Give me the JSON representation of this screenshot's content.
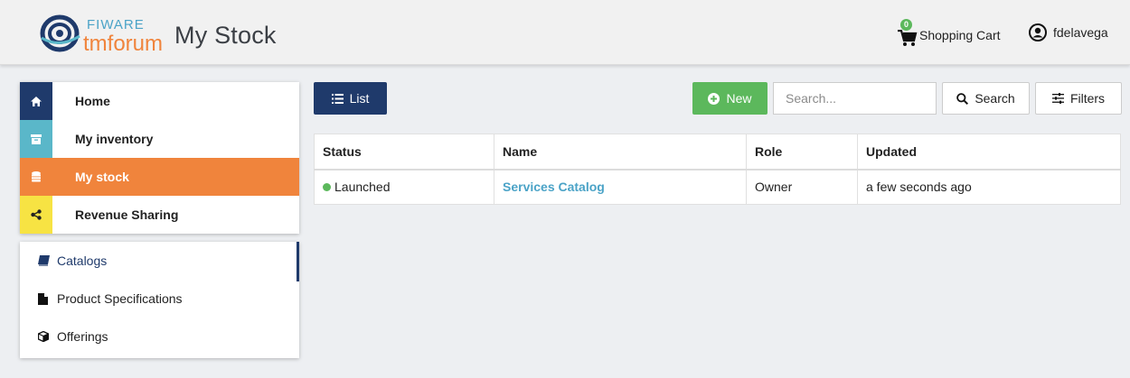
{
  "header": {
    "app_title": "My Stock",
    "cart_label": "Shopping Cart",
    "cart_count": "0",
    "username": "fdelavega"
  },
  "nav_main": [
    {
      "label": "Home",
      "icon": "home-icon",
      "color": "#1f3a6b"
    },
    {
      "label": "My inventory",
      "icon": "archive-icon",
      "color": "#5ab7c9"
    },
    {
      "label": "My stock",
      "icon": "database-icon",
      "color": "#f0843c",
      "active": true
    },
    {
      "label": "Revenue Sharing",
      "icon": "share-icon",
      "color": "#f7e343"
    }
  ],
  "nav_sub": [
    {
      "label": "Catalogs",
      "icon": "book-icon",
      "active": true
    },
    {
      "label": "Product Specifications",
      "icon": "file-icon"
    },
    {
      "label": "Offerings",
      "icon": "cube-icon"
    }
  ],
  "toolbar": {
    "list_label": "List",
    "new_label": "New",
    "search_placeholder": "Search...",
    "search_label": "Search",
    "filters_label": "Filters"
  },
  "table": {
    "columns": [
      "Status",
      "Name",
      "Role",
      "Updated"
    ],
    "rows": [
      {
        "status": "Launched",
        "name": "Services Catalog",
        "role": "Owner",
        "updated": "a few seconds ago"
      }
    ]
  },
  "colors": {
    "accent_navy": "#1f3a6b",
    "accent_orange": "#f0843c",
    "accent_green": "#5cb85c",
    "link_blue": "#4ba3c7"
  }
}
